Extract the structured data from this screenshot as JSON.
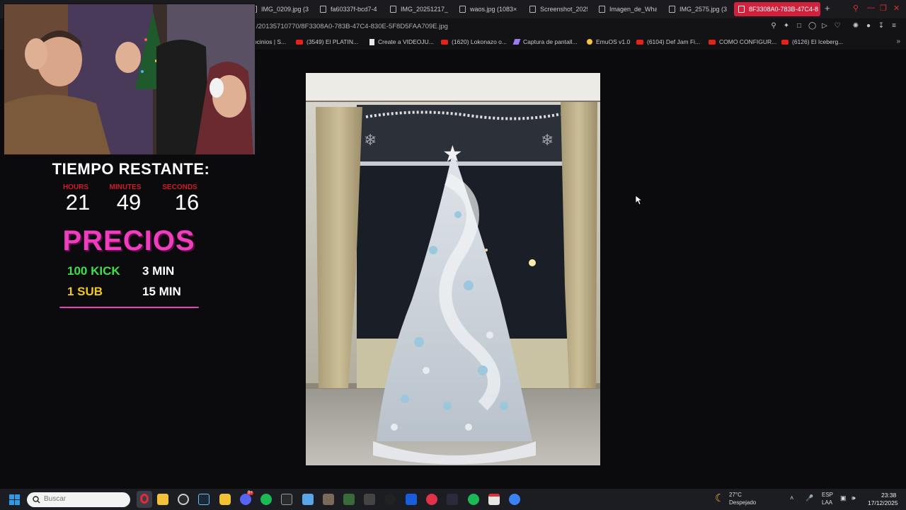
{
  "browser": {
    "tabs": [
      {
        "label": "IMG_0209.jpg (3",
        "active": false
      },
      {
        "label": "fa60337f-bcd7-4",
        "active": false
      },
      {
        "label": "IMG_20251217_21",
        "active": false
      },
      {
        "label": "waos.jpg (1083×",
        "active": false
      },
      {
        "label": "Screenshot_2025",
        "active": false
      },
      {
        "label": "Imagen_de_What",
        "active": false
      },
      {
        "label": "IMG_2575.jpg (3",
        "active": false
      },
      {
        "label": "8F3308A0-783B-47C4-8",
        "active": true
      }
    ],
    "new_tab_label": "+",
    "url": "/20135710770/8F3308A0-783B-47C4-830E-5F8D5FAA709E.jpg",
    "bookmarks": [
      {
        "label": "ocinios | S...",
        "icon": "doc-icon"
      },
      {
        "label": "(3549) El PLATIN...",
        "icon": "youtube-icon"
      },
      {
        "label": "Create a VIDEOJU...",
        "icon": "doc-icon"
      },
      {
        "label": "(1620) Lokonazo o...",
        "icon": "youtube-icon"
      },
      {
        "label": "Captura de pantall...",
        "icon": "pen-icon"
      },
      {
        "label": "EmuOS v1.0",
        "icon": "globe-icon"
      },
      {
        "label": "(6104) Def Jam Fi...",
        "icon": "youtube-icon"
      },
      {
        "label": "COMO CONFIGUR...",
        "icon": "youtube-icon"
      },
      {
        "label": "(6126) El Iceberg...",
        "icon": "youtube-icon"
      }
    ],
    "accent": "#d0213d"
  },
  "overlay": {
    "timer_title": "TIEMPO RESTANTE:",
    "timer": [
      {
        "label": "HOURS",
        "value": "21"
      },
      {
        "label": "MINUTES",
        "value": "49"
      },
      {
        "label": "SECONDS",
        "value": "16"
      }
    ],
    "prices_title": "PRECIOS",
    "prices": [
      {
        "item": "100 KICK",
        "time": "3 MIN",
        "color": "#3ee04a"
      },
      {
        "item": "1 SUB",
        "time": "15 MIN",
        "color": "#f2c81c"
      }
    ],
    "accent": "#ee3dbd"
  },
  "taskbar": {
    "search_placeholder": "Buscar",
    "apps": [
      "opera-icon",
      "file-explorer-icon",
      "chrome-icon",
      "steam-icon",
      "shield-app-icon",
      "discord-icon",
      "spotify-icon",
      "obs-icon",
      "notepad-icon",
      "game-icon",
      "xbox-icon",
      "car-icon",
      "cut-icon",
      "bitwarden-icon",
      "record-icon",
      "pen-app-icon",
      "spotify-icon",
      "calendar-icon",
      "blue-app-icon"
    ],
    "discord_badge": "9+",
    "weather_temp": "27°C",
    "weather_desc": "Despejado",
    "lang_top": "ESP",
    "lang_bottom": "LAA",
    "time": "23:38",
    "date": "17/12/2025"
  }
}
